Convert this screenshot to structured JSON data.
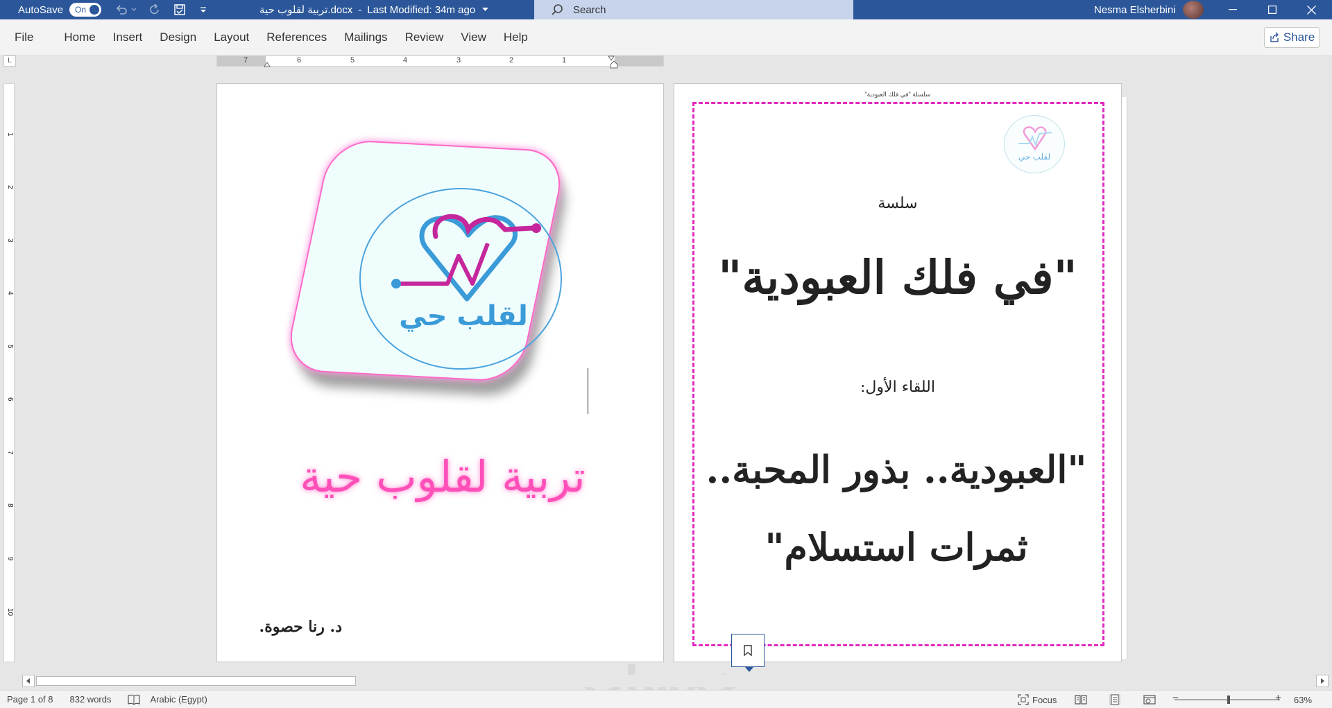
{
  "titlebar": {
    "autosave_label": "AutoSave",
    "autosave_state": "On",
    "doc_name": "تربية لقلوب حية.docx",
    "separator": "-",
    "last_modified": "Last Modified: 34m ago",
    "search_placeholder": "Search",
    "user_name": "Nesma Elsherbini"
  },
  "menu": {
    "items": [
      "File",
      "Home",
      "Insert",
      "Design",
      "Layout",
      "References",
      "Mailings",
      "Review",
      "View",
      "Help"
    ],
    "share_label": "Share"
  },
  "ruler": {
    "h_numbers": [
      "7",
      "6",
      "5",
      "4",
      "3",
      "2",
      "1"
    ],
    "v_numbers": [
      "1",
      "2",
      "3",
      "4",
      "5",
      "6",
      "7",
      "8",
      "9",
      "10"
    ],
    "corner_glyph": "L"
  },
  "left_page": {
    "logo_text": "لقلب حي",
    "main_title": "تربية لقلوب حية",
    "author": "د. رنا حصوة."
  },
  "right_page": {
    "header_text": "سلسلة \"في فلك العبودية\"",
    "small_logo_text": "لقلب حي",
    "series_label": "سلسة",
    "series_title": "\"في فلك العبودية\"",
    "meeting_label": "اللقاء الأول:",
    "meeting_title_line1": "\"العبودية.. بذور المحبة..",
    "meeting_title_line2": "ثمرات استسلام\""
  },
  "watermark": "خمسات",
  "statusbar": {
    "page_info": "Page 1 of 8",
    "word_count": "832 words",
    "language": "Arabic (Egypt)",
    "focus_label": "Focus",
    "zoom_minus": "−",
    "zoom_plus": "+",
    "zoom_level": "63%"
  },
  "colors": {
    "accent": "#2b579a",
    "page_border": "#e02abf",
    "title_pink": "#ff4fb8",
    "logo_blue": "#3a9bd8",
    "logo_magenta": "#c5269c"
  }
}
